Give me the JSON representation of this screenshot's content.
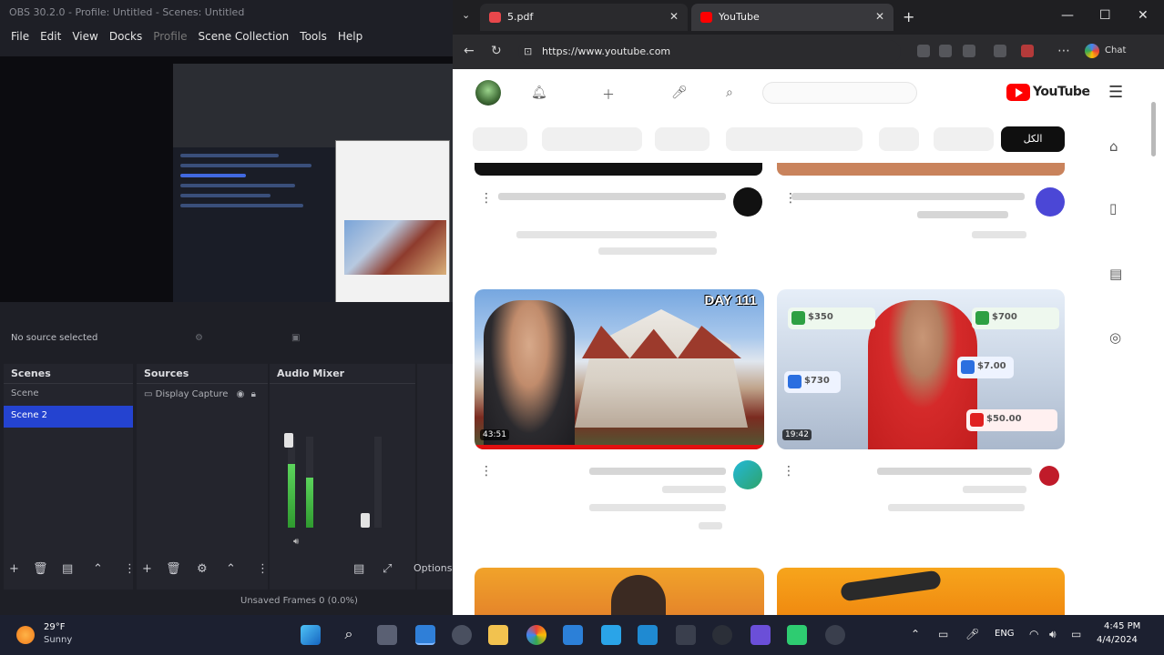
{
  "obs": {
    "title": "OBS 30.2.0 - Profile: Untitled - Scenes: Untitled",
    "menu": [
      "File",
      "Edit",
      "View",
      "Docks",
      "Profile",
      "Scene Collection",
      "Tools",
      "Help"
    ],
    "source_bar": {
      "label": "No source selected"
    },
    "docks": {
      "scenes": {
        "title": "Scenes",
        "items": [
          "Scene",
          "Scene 2"
        ],
        "active_index": 1
      },
      "sources": {
        "title": "Sources",
        "items": [
          "Display Capture"
        ]
      },
      "mixer": {
        "title": "Audio Mixer"
      }
    },
    "toolbar": {
      "options_label": "Options"
    },
    "status": {
      "recording": "Unsaved Frames 0 (0.0%)"
    }
  },
  "browser": {
    "tabs": [
      {
        "label": "5.pdf",
        "favicon_color": "#e8474b"
      },
      {
        "label": "YouTube",
        "favicon_color": "#ff0000"
      }
    ],
    "url": "https://www.youtube.com",
    "profile_label": "Chat"
  },
  "youtube": {
    "logo_text": "YouTube",
    "chip_active": "الكل",
    "videos": [
      {
        "thumb_text": "DAY 111",
        "duration_badge": "43:51",
        "progress": 1.0
      },
      {
        "card1": "$350",
        "card2": "$700",
        "card3": "$730",
        "card4": "$7.00",
        "card5": "$50.00",
        "duration_badge": "19:42"
      }
    ]
  },
  "taskbar": {
    "weather_temp": "29°F",
    "weather_desc": "Sunny",
    "language": "ENG",
    "time": "4:45 PM",
    "date": "4/4/2024"
  },
  "colors": {
    "obs_bg": "#1e1f26",
    "scene_active": "#2443d0",
    "youtube_red": "#ff0000",
    "taskbar": "#1c2030"
  }
}
